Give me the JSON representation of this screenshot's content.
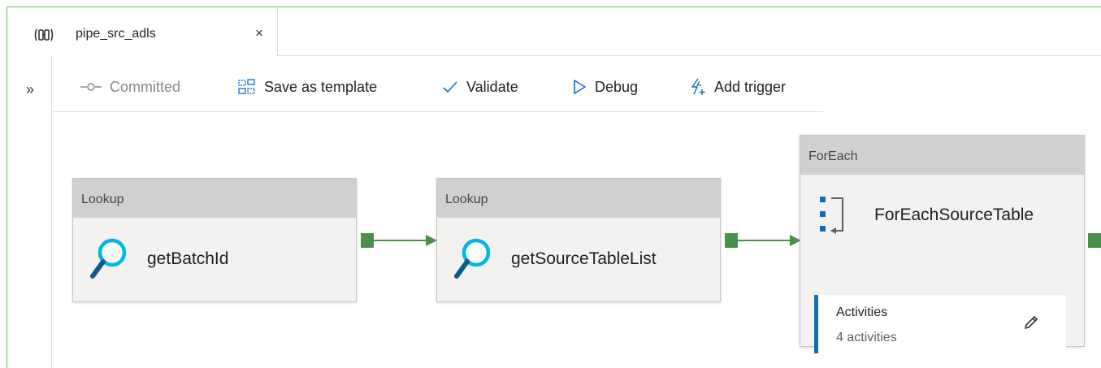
{
  "tab": {
    "title": "pipe_src_adls",
    "close_glyph": "×",
    "icon": "pipeline-icon"
  },
  "sidebar": {
    "expand_glyph": "»"
  },
  "toolbar": {
    "committed_label": "Committed",
    "save_template_label": "Save as template",
    "validate_label": "Validate",
    "debug_label": "Debug",
    "add_trigger_label": "Add trigger"
  },
  "canvas": {
    "activities": [
      {
        "type": "Lookup",
        "name": "getBatchId",
        "icon": "search-icon"
      },
      {
        "type": "Lookup",
        "name": "getSourceTableList",
        "icon": "search-icon"
      },
      {
        "type": "ForEach",
        "name": "ForEachSourceTable",
        "icon": "foreach-icon",
        "inner": {
          "label": "Activities",
          "count": "4 activities"
        }
      }
    ]
  },
  "colors": {
    "frame_border": "#6bbf6b",
    "connector": "#4a8f4a",
    "activities_accent": "#0f6cbd",
    "search_icon": "#00b7e8"
  }
}
